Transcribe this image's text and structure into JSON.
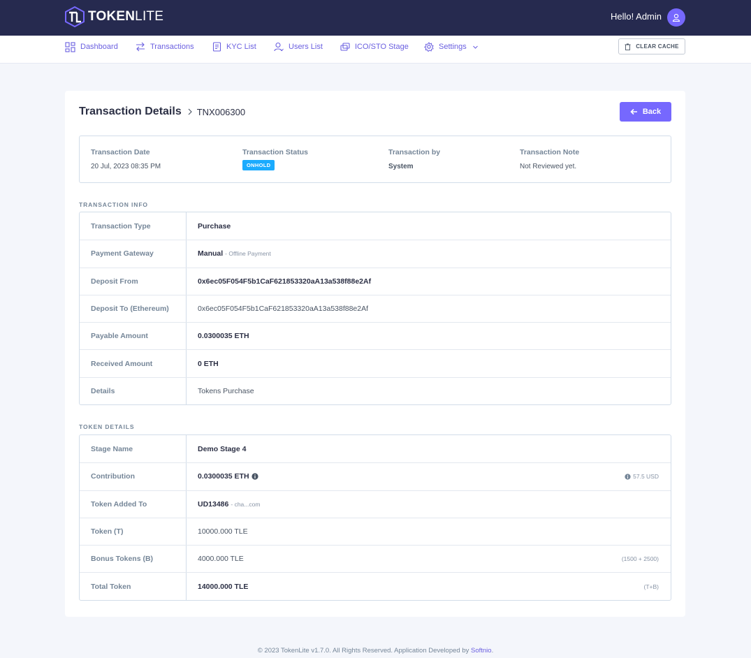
{
  "header": {
    "logo_bold": "TOKEN",
    "logo_light": "LITE",
    "greeting": "Hello! Admin"
  },
  "nav": {
    "items": [
      {
        "label": "Dashboard",
        "icon": "dashboard-icon"
      },
      {
        "label": "Transactions",
        "icon": "transactions-icon"
      },
      {
        "label": "KYC List",
        "icon": "kyc-list-icon"
      },
      {
        "label": "Users List",
        "icon": "users-icon"
      },
      {
        "label": "ICO/STO Stage",
        "icon": "stage-icon"
      },
      {
        "label": "Settings",
        "icon": "gear-icon"
      }
    ],
    "clear_cache": "CLEAR CACHE"
  },
  "page": {
    "title": "Transaction Details",
    "tnx_id": "TNX006300",
    "back_label": "Back"
  },
  "summary": {
    "date_label": "Transaction Date",
    "date_value": "20 Jul, 2023 08:35 PM",
    "status_label": "Transaction Status",
    "status_value": "ONHOLD",
    "by_label": "Transaction by",
    "by_value": "System",
    "note_label": "Transaction Note",
    "note_value": "Not Reviewed yet."
  },
  "transaction_info": {
    "section_label": "TRANSACTION INFO",
    "rows": [
      {
        "key": "Transaction Type",
        "value": "Purchase"
      },
      {
        "key": "Payment Gateway",
        "value": "Manual",
        "sub": "- Offline Payment"
      },
      {
        "key": "Deposit From",
        "value": "0x6ec05F054F5b1CaF621853320aA13a538f88e2Af"
      },
      {
        "key": "Deposit To (Ethereum)",
        "value": "0x6ec05F054F5b1CaF621853320aA13a538f88e2Af"
      },
      {
        "key": "Payable Amount",
        "value": "0.0300035 ETH"
      },
      {
        "key": "Received Amount",
        "value": "0 ETH"
      },
      {
        "key": "Details",
        "value": "Tokens Purchase"
      }
    ]
  },
  "token_details": {
    "section_label": "TOKEN DETAILS",
    "rows": [
      {
        "key": "Stage Name",
        "value": "Demo Stage 4"
      },
      {
        "key": "Contribution",
        "value": "0.0300035 ETH",
        "right": "57.5 USD"
      },
      {
        "key": "Token Added To",
        "value": "UD13486",
        "sub": "- cha...com"
      },
      {
        "key": "Token (T)",
        "value": "10000.000 TLE"
      },
      {
        "key": "Bonus Tokens (B)",
        "value": "4000.000 TLE",
        "right": "(1500 + 2500)"
      },
      {
        "key": "Total Token",
        "value": "14000.000 TLE",
        "right": "(T+B)"
      }
    ]
  },
  "footer": {
    "text": "© 2023 TokenLite v1.7.0. All Rights Reserved. Application Developed by",
    "link": "Softnio",
    "period": "."
  },
  "colors": {
    "header_bg": "#262a4f",
    "accent": "#7668fe",
    "status_badge": "#1babfe"
  }
}
